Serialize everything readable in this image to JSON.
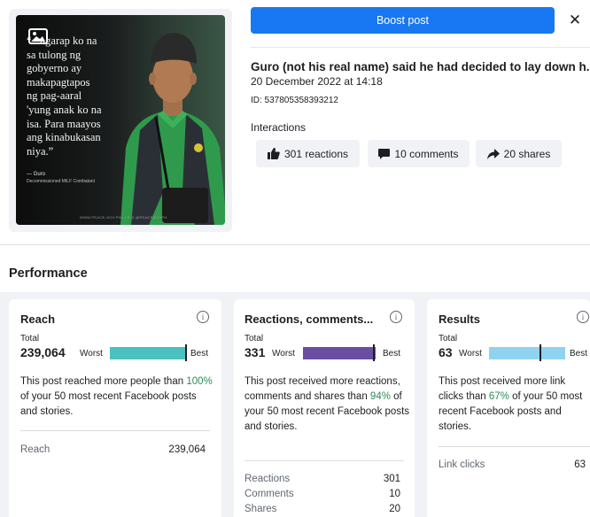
{
  "post": {
    "image_quote_lines": [
      "“...ngarap ko na",
      "sa tulong ng",
      "gobyerno ay",
      "makapagtapos",
      "ng pag-aaral",
      "'yung anak ko na",
      "isa. Para maayos",
      "ang kinabukasan",
      "niya.”"
    ],
    "image_author": "— Guro",
    "image_author_sub": "Decommissioned MILF Combatant",
    "image_footer": "WWW.PEACE.GOV.PH  |  f ♥ ◎ @PEACEGOVPH",
    "title": "Guro (not his real name) said he had decided to lay down h...",
    "date": "20 December 2022 at 14:18",
    "id": "ID: 537805358393212"
  },
  "toolbar": {
    "boost_label": "Boost post",
    "close_glyph": "✕"
  },
  "interactions": {
    "label": "Interactions",
    "reactions": "301 reactions",
    "comments": "10 comments",
    "shares": "20 shares"
  },
  "performance": {
    "title": "Performance",
    "reach": {
      "title": "Reach",
      "total_label": "Total",
      "total": "239,064",
      "worst": "Worst",
      "best": "Best",
      "bar_color": "#4bc0c0",
      "marker_position": 1.0,
      "desc_pre": "This post reached more people than ",
      "desc_pct": "100%",
      "desc_post": " of your 50 most recent Facebook posts and stories.",
      "metrics": [
        {
          "label": "Reach",
          "value": "239,064"
        }
      ]
    },
    "rcs": {
      "title": "Reactions, comments...",
      "total_label": "Total",
      "total": "331",
      "worst": "Worst",
      "best": "Best",
      "bar_color": "#6a4fa0",
      "marker_position": 0.94,
      "desc_pre": "This post received more reactions, comments and shares than ",
      "desc_pct": "94%",
      "desc_post": " of your 50 most recent Facebook posts and stories.",
      "metrics": [
        {
          "label": "Reactions",
          "value": "301"
        },
        {
          "label": "Comments",
          "value": "10"
        },
        {
          "label": "Shares",
          "value": "20"
        }
      ]
    },
    "results": {
      "title": "Results",
      "total_label": "Total",
      "total": "63",
      "worst": "Worst",
      "best": "Best",
      "bar_color": "#8fd3f0",
      "marker_position": 0.67,
      "desc_pre": "This post received more link clicks than ",
      "desc_pct": "67%",
      "desc_post": " of your 50 most recent Facebook posts and stories.",
      "metrics": [
        {
          "label": "Link clicks",
          "value": "63"
        }
      ]
    }
  },
  "colors": {
    "accent": "#1877f2",
    "positive": "#2e8b57",
    "panel_bg": "#f0f2f5"
  }
}
